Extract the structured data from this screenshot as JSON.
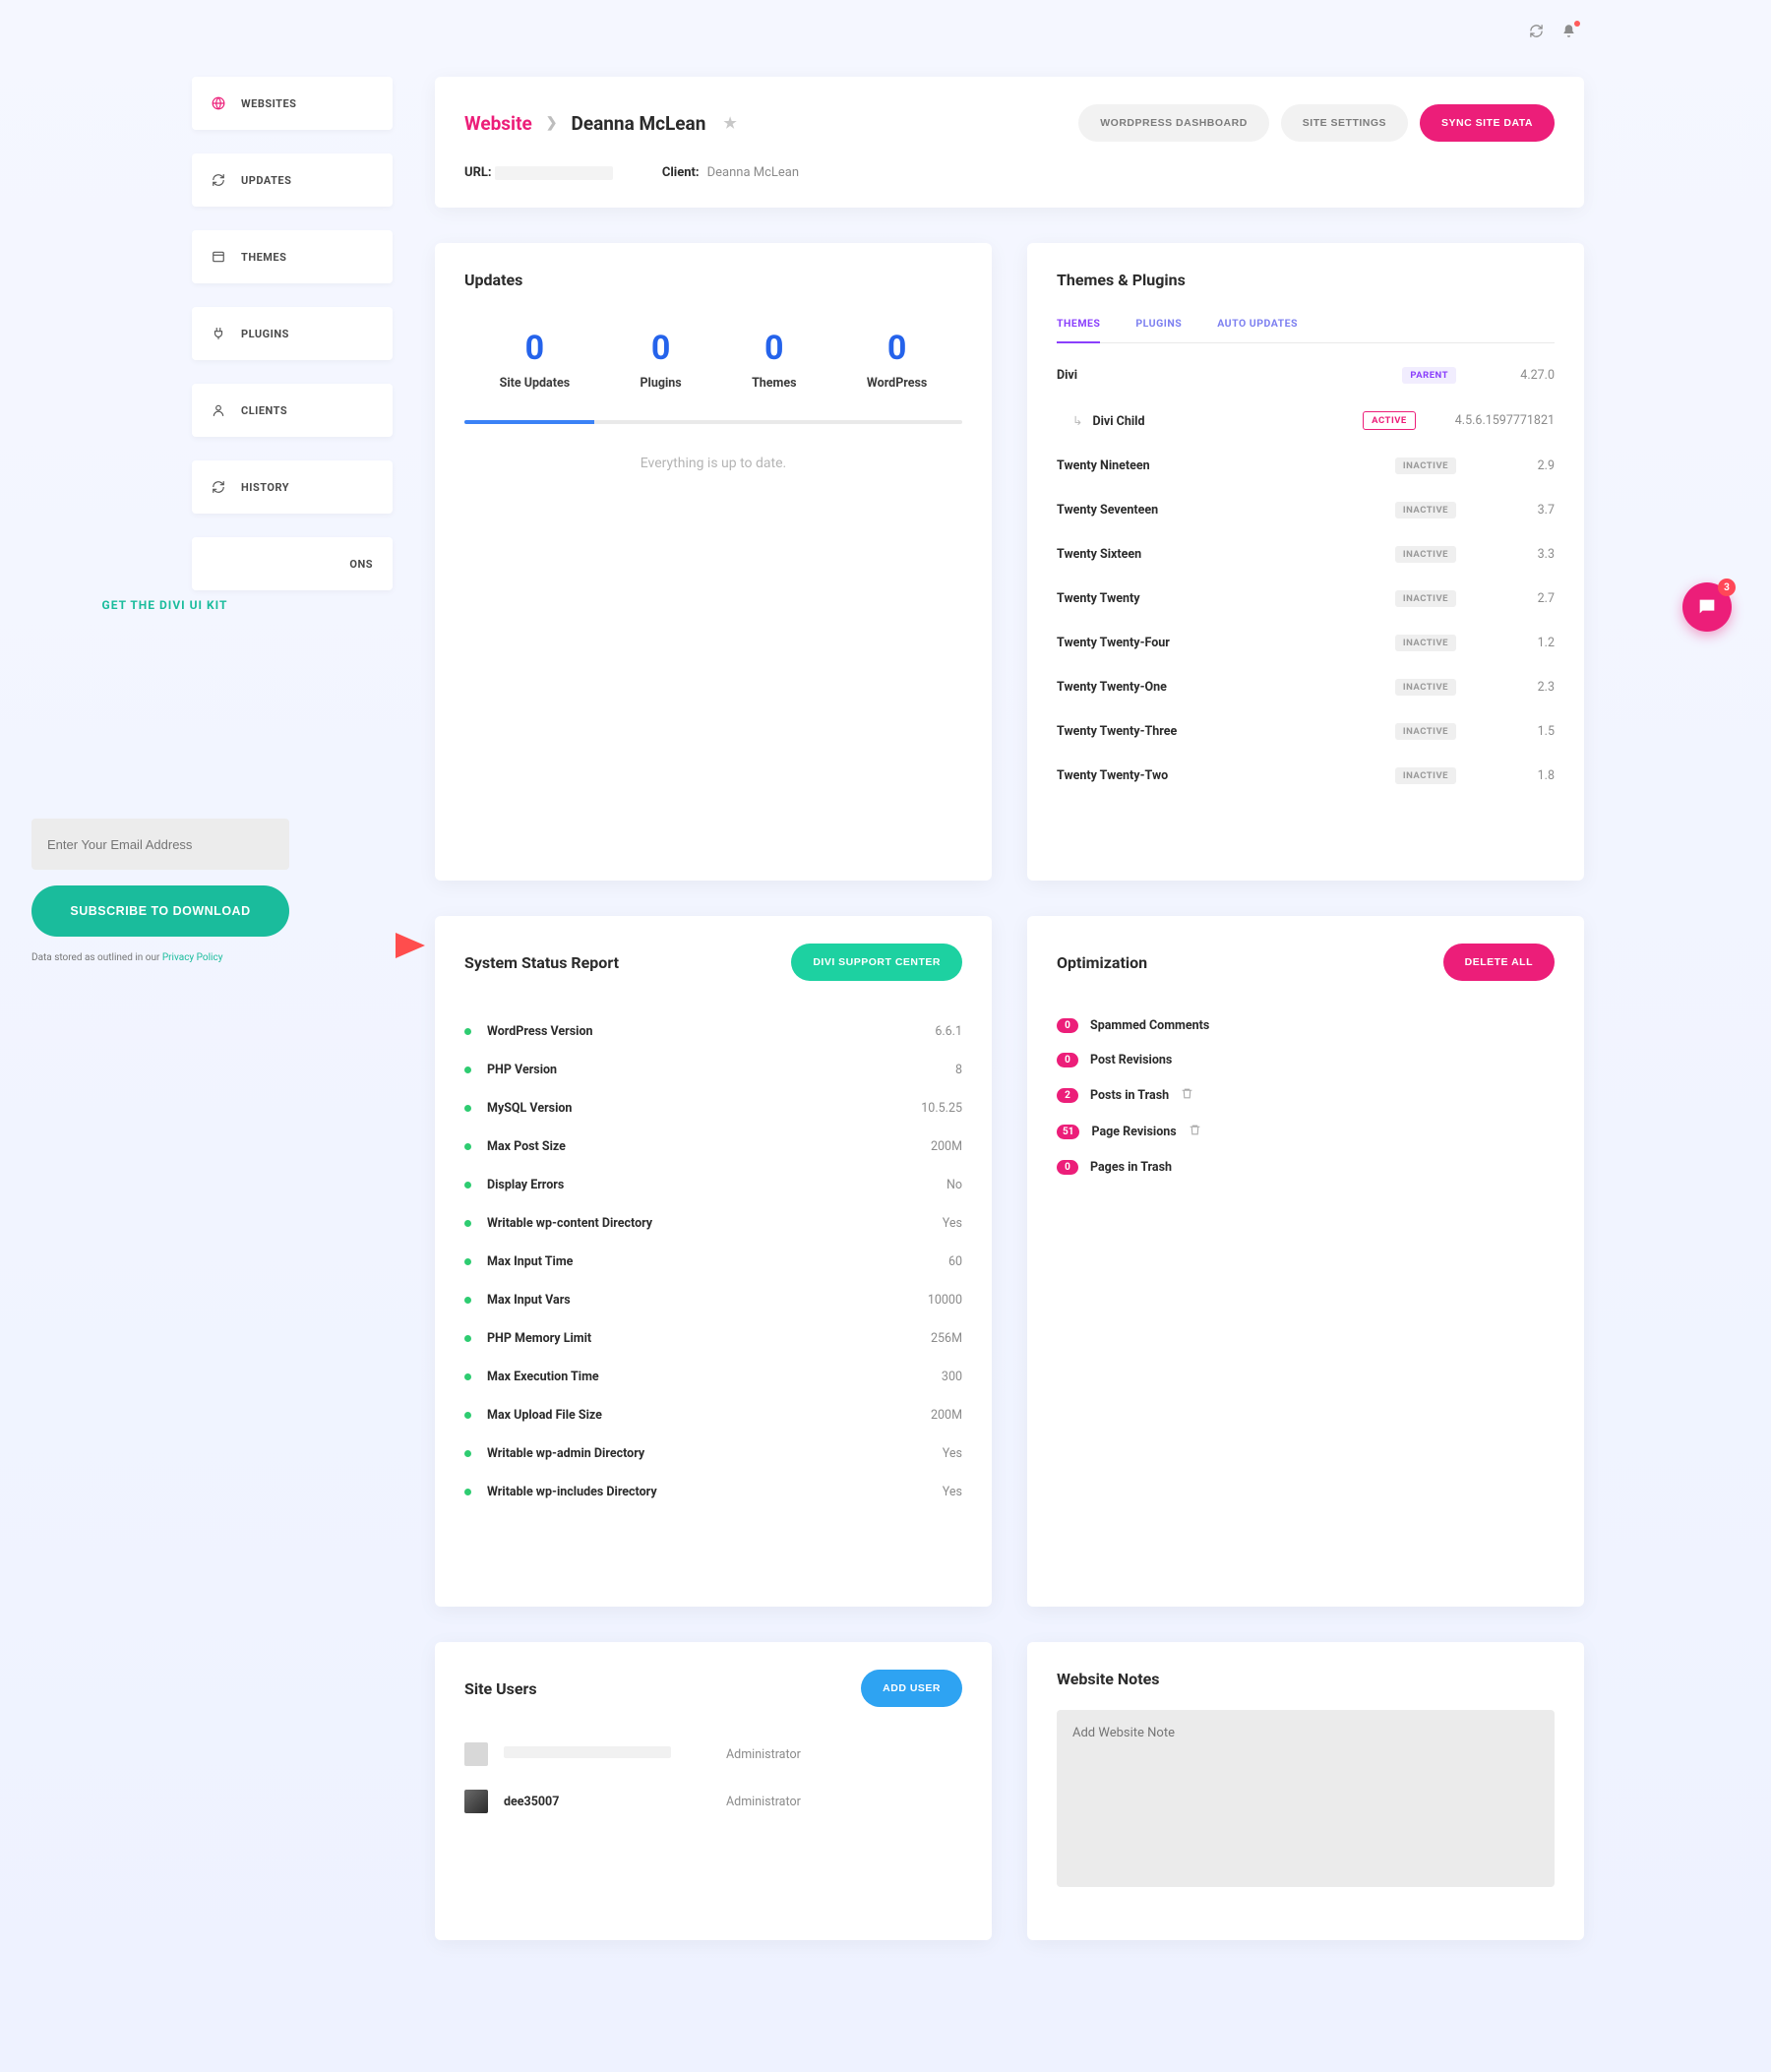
{
  "topicons": {
    "refresh": "refresh-icon",
    "bell": "bell-icon"
  },
  "sidebar": {
    "items": [
      {
        "label": "WEBSITES",
        "icon": "globe"
      },
      {
        "label": "UPDATES",
        "icon": "refresh"
      },
      {
        "label": "THEMES",
        "icon": "window"
      },
      {
        "label": "PLUGINS",
        "icon": "plug"
      },
      {
        "label": "CLIENTS",
        "icon": "user"
      },
      {
        "label": "HISTORY",
        "icon": "refresh"
      }
    ],
    "hidden_tab_suffix": "ONS"
  },
  "promo": {
    "title": "GET THE DIVI UI KIT",
    "placeholder": "Enter Your Email Address",
    "button": "SUBSCRIBE TO DOWNLOAD",
    "disclaimer_prefix": "Data stored as outlined in our ",
    "disclaimer_link": "Privacy Policy"
  },
  "header": {
    "root": "Website",
    "name": "Deanna McLean",
    "buttons": {
      "wp": "WORDPRESS DASHBOARD",
      "settings": "SITE SETTINGS",
      "sync": "SYNC SITE DATA"
    },
    "url_label": "URL:",
    "client_label": "Client:",
    "client_value": "Deanna McLean"
  },
  "updates": {
    "title": "Updates",
    "stats": [
      {
        "num": "0",
        "label": "Site Updates"
      },
      {
        "num": "0",
        "label": "Plugins"
      },
      {
        "num": "0",
        "label": "Themes"
      },
      {
        "num": "0",
        "label": "WordPress"
      }
    ],
    "message": "Everything is up to date."
  },
  "tp": {
    "title": "Themes & Plugins",
    "tabs": {
      "themes": "THEMES",
      "plugins": "PLUGINS",
      "auto": "AUTO UPDATES"
    },
    "rows": [
      {
        "name": "Divi",
        "status": "PARENT",
        "status_type": "parent",
        "version": "4.27.0",
        "child": false
      },
      {
        "name": "Divi Child",
        "status": "ACTIVE",
        "status_type": "active",
        "version": "4.5.6.1597771821",
        "child": true
      },
      {
        "name": "Twenty Nineteen",
        "status": "INACTIVE",
        "status_type": "inactive",
        "version": "2.9",
        "child": false
      },
      {
        "name": "Twenty Seventeen",
        "status": "INACTIVE",
        "status_type": "inactive",
        "version": "3.7",
        "child": false
      },
      {
        "name": "Twenty Sixteen",
        "status": "INACTIVE",
        "status_type": "inactive",
        "version": "3.3",
        "child": false
      },
      {
        "name": "Twenty Twenty",
        "status": "INACTIVE",
        "status_type": "inactive",
        "version": "2.7",
        "child": false
      },
      {
        "name": "Twenty Twenty-Four",
        "status": "INACTIVE",
        "status_type": "inactive",
        "version": "1.2",
        "child": false
      },
      {
        "name": "Twenty Twenty-One",
        "status": "INACTIVE",
        "status_type": "inactive",
        "version": "2.3",
        "child": false
      },
      {
        "name": "Twenty Twenty-Three",
        "status": "INACTIVE",
        "status_type": "inactive",
        "version": "1.5",
        "child": false
      },
      {
        "name": "Twenty Twenty-Two",
        "status": "INACTIVE",
        "status_type": "inactive",
        "version": "1.8",
        "child": false
      }
    ]
  },
  "system": {
    "title": "System Status Report",
    "button": "DIVI SUPPORT CENTER",
    "rows": [
      {
        "name": "WordPress Version",
        "value": "6.6.1"
      },
      {
        "name": "PHP Version",
        "value": "8"
      },
      {
        "name": "MySQL Version",
        "value": "10.5.25"
      },
      {
        "name": "Max Post Size",
        "value": "200M"
      },
      {
        "name": "Display Errors",
        "value": "No"
      },
      {
        "name": "Writable wp-content Directory",
        "value": "Yes"
      },
      {
        "name": "Max Input Time",
        "value": "60"
      },
      {
        "name": "Max Input Vars",
        "value": "10000"
      },
      {
        "name": "PHP Memory Limit",
        "value": "256M"
      },
      {
        "name": "Max Execution Time",
        "value": "300"
      },
      {
        "name": "Max Upload File Size",
        "value": "200M"
      },
      {
        "name": "Writable wp-admin Directory",
        "value": "Yes"
      },
      {
        "name": "Writable wp-includes Directory",
        "value": "Yes"
      }
    ]
  },
  "optimization": {
    "title": "Optimization",
    "button": "DELETE ALL",
    "rows": [
      {
        "count": "0",
        "label": "Spammed Comments",
        "trash": false
      },
      {
        "count": "0",
        "label": "Post Revisions",
        "trash": false
      },
      {
        "count": "2",
        "label": "Posts in Trash",
        "trash": true
      },
      {
        "count": "51",
        "label": "Page Revisions",
        "trash": true
      },
      {
        "count": "0",
        "label": "Pages in Trash",
        "trash": false
      }
    ]
  },
  "users": {
    "title": "Site Users",
    "button": "ADD USER",
    "rows": [
      {
        "name": "",
        "role": "Administrator",
        "hidden": true
      },
      {
        "name": "dee35007",
        "role": "Administrator",
        "hidden": false
      }
    ]
  },
  "notes": {
    "title": "Website Notes",
    "placeholder": "Add Website Note"
  },
  "chat": {
    "badge": "3"
  }
}
